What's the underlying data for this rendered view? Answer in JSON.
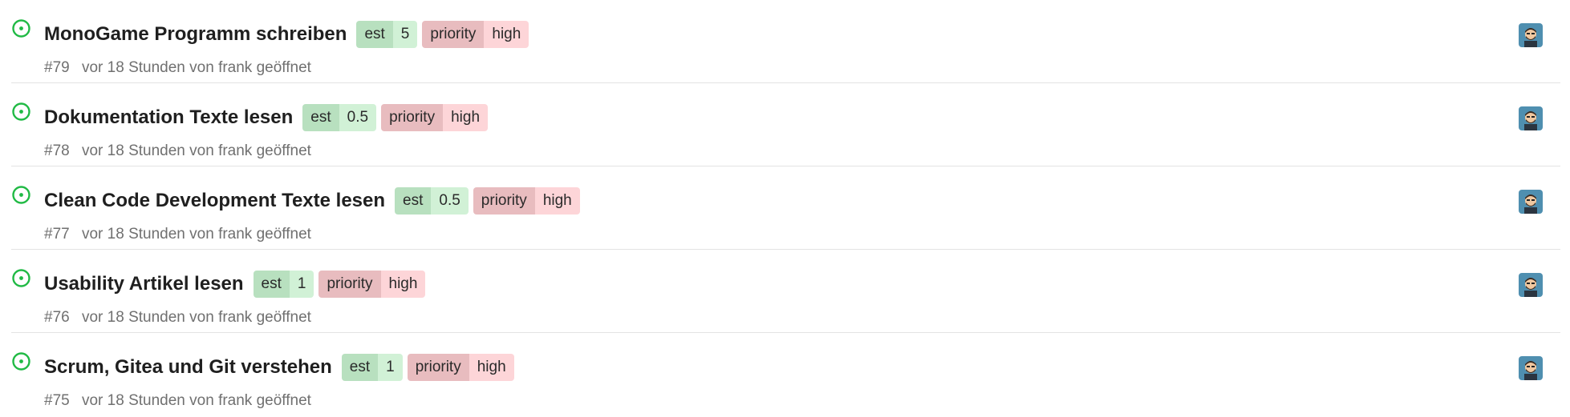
{
  "colors": {
    "open_icon": "#21ba45",
    "est_scope_bg": "#b8e0bf",
    "est_value_bg": "#d1f1d6",
    "priority_scope_bg": "#e8bcbf",
    "priority_value_bg": "#fdd5d8",
    "meta_text": "#707070",
    "avatar_bg": "#4f8fb0"
  },
  "icons": {
    "status": "issue-open-icon",
    "avatar": "user-avatar"
  },
  "issues": [
    {
      "title": "MonoGame Programm schreiben",
      "labels": [
        {
          "scope": "est",
          "value": "5"
        },
        {
          "scope": "priority",
          "value": "high"
        }
      ],
      "number": "#79",
      "opened": "vor 18 Stunden von",
      "author": "frank",
      "suffix": "geöffnet"
    },
    {
      "title": "Dokumentation Texte lesen",
      "labels": [
        {
          "scope": "est",
          "value": "0.5"
        },
        {
          "scope": "priority",
          "value": "high"
        }
      ],
      "number": "#78",
      "opened": "vor 18 Stunden von",
      "author": "frank",
      "suffix": "geöffnet"
    },
    {
      "title": "Clean Code Development Texte lesen",
      "labels": [
        {
          "scope": "est",
          "value": "0.5"
        },
        {
          "scope": "priority",
          "value": "high"
        }
      ],
      "number": "#77",
      "opened": "vor 18 Stunden von",
      "author": "frank",
      "suffix": "geöffnet"
    },
    {
      "title": "Usability Artikel lesen",
      "labels": [
        {
          "scope": "est",
          "value": "1"
        },
        {
          "scope": "priority",
          "value": "high"
        }
      ],
      "number": "#76",
      "opened": "vor 18 Stunden von",
      "author": "frank",
      "suffix": "geöffnet"
    },
    {
      "title": "Scrum, Gitea und Git verstehen",
      "labels": [
        {
          "scope": "est",
          "value": "1"
        },
        {
          "scope": "priority",
          "value": "high"
        }
      ],
      "number": "#75",
      "opened": "vor 18 Stunden von",
      "author": "frank",
      "suffix": "geöffnet"
    }
  ]
}
